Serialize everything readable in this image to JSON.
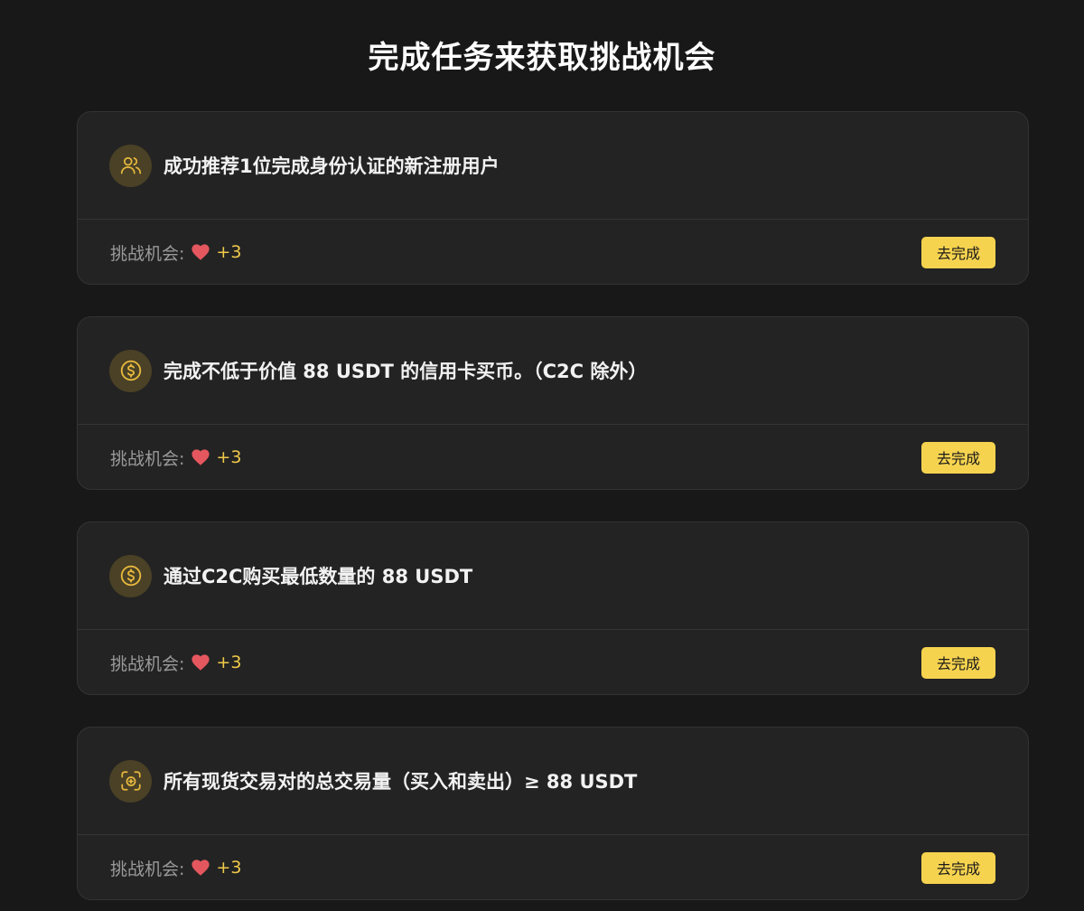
{
  "page": {
    "title": "完成任务来获取挑战机会"
  },
  "colors": {
    "background": "#181818",
    "card": "#232323",
    "accent": "#f6d34f",
    "reward_value": "#f0c94a",
    "heart": "#e5575f"
  },
  "tasks": [
    {
      "icon": "users-icon",
      "title": "成功推荐1位完成身份认证的新注册用户",
      "reward_label": "挑战机会:",
      "reward_value": "+3",
      "button_label": "去完成"
    },
    {
      "icon": "dollar-coin-icon",
      "title": "完成不低于价值 88 USDT 的信用卡买币。（C2C 除外）",
      "reward_label": "挑战机会:",
      "reward_value": "+3",
      "button_label": "去完成"
    },
    {
      "icon": "dollar-coin-icon",
      "title": "通过C2C购买最低数量的 88 USDT",
      "reward_label": "挑战机会:",
      "reward_value": "+3",
      "button_label": "去完成"
    },
    {
      "icon": "spot-trade-icon",
      "title": "所有现货交易对的总交易量（买入和卖出）≥ 88 USDT",
      "reward_label": "挑战机会:",
      "reward_value": "+3",
      "button_label": "去完成"
    }
  ]
}
